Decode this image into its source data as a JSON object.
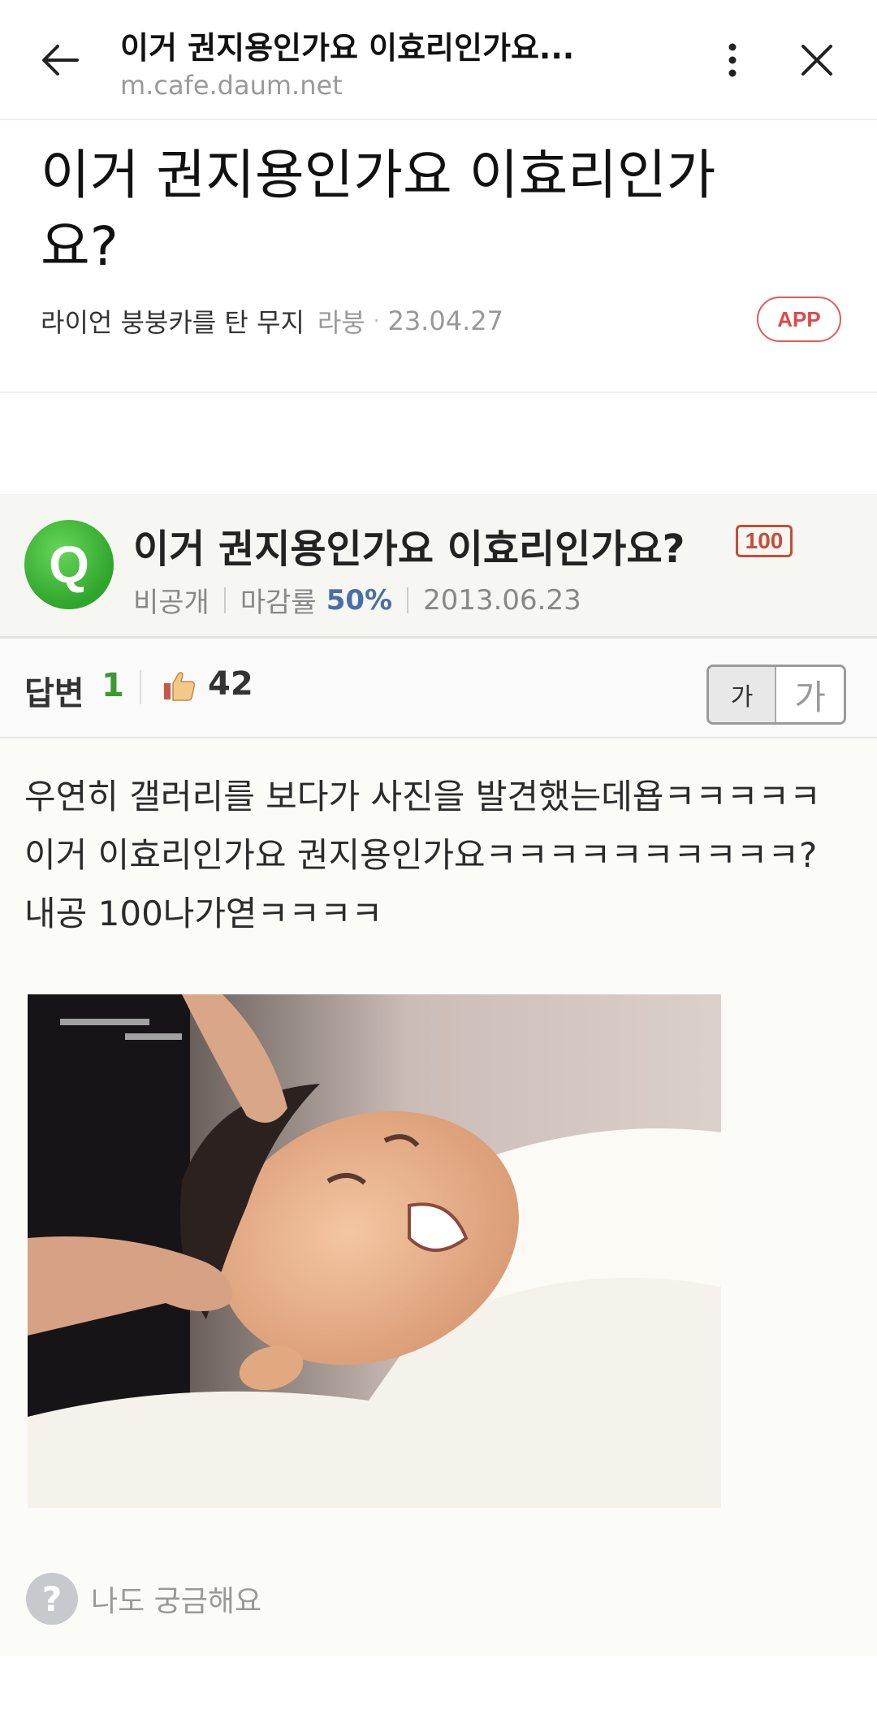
{
  "browser": {
    "title": "이거 권지용인가요 이효리인가요...",
    "url": "m.cafe.daum.net",
    "back_icon": "arrow-left-icon",
    "menu_icon": "kebab-menu-icon",
    "close_icon": "close-icon"
  },
  "article": {
    "title": "이거 권지용인가요 이효리인가요?",
    "author": "라이언 붕붕카를 탄 무지",
    "board": "라붕",
    "date": "23.04.27",
    "app_badge": "APP"
  },
  "embedded_qna": {
    "question_title": "이거 권지용인가요 이효리인가요?",
    "points": "100",
    "visibility": "비공개",
    "deadline_label": "마감률",
    "deadline_rate": "50%",
    "date": "2013.06.23",
    "answer_label": "답변",
    "answer_count": "1",
    "likes": "42",
    "font_small": "가",
    "font_large": "가",
    "answer_text": "우연히 갤러리를 보다가 사진을 발견했는데욥ㅋㅋㅋㅋㅋ이거 이효리인가요 권지용인가요ㅋㅋㅋㅋㅋㅋㅋㅋㅋㅋ? 내공 100나가엳ㅋㅋㅋㅋ",
    "curious_label": "나도 궁금해요"
  },
  "colors": {
    "accent_green": "#3a9a30",
    "app_badge_red": "#e14848",
    "rate_blue": "#4b6ea8"
  }
}
